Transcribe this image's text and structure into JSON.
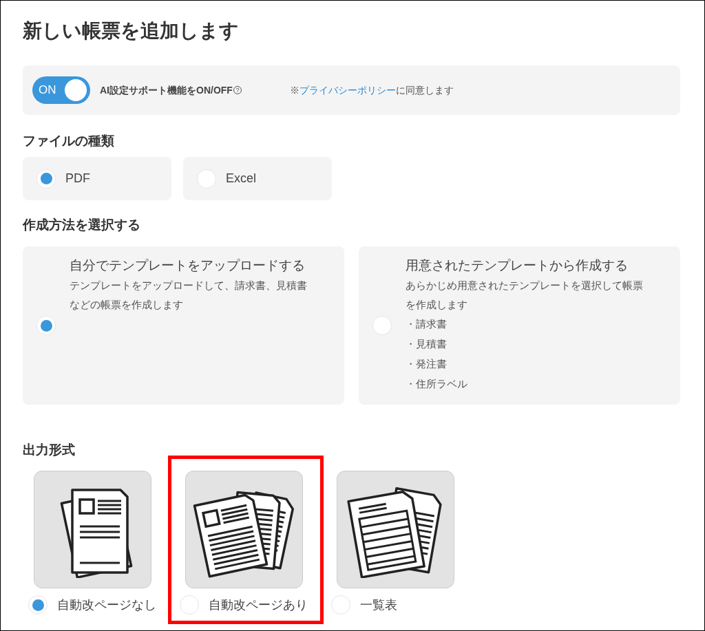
{
  "title": "新しい帳票を追加します",
  "ai_support": {
    "on": true,
    "toggle_label": "ON",
    "label": "AI設定サポート機能をON/OFF",
    "help_icon": "?",
    "note_prefix": "※",
    "privacy_link": "プライバシーポリシー",
    "note_suffix": "に同意します"
  },
  "file_type": {
    "heading": "ファイルの種類",
    "options": [
      {
        "label": "PDF",
        "selected": true
      },
      {
        "label": "Excel",
        "selected": false
      }
    ]
  },
  "method": {
    "heading": "作成方法を選択する",
    "options": [
      {
        "title": "自分でテンプレートをアップロードする",
        "description": "テンプレートをアップロードして、請求書、見積書などの帳票を作成します",
        "selected": true
      },
      {
        "title": "用意されたテンプレートから作成する",
        "description": "あらかじめ用意されたテンプレートを選択して帳票を作成します",
        "items": [
          "・請求書",
          "・見積書",
          "・発注書",
          "・住所ラベル"
        ],
        "selected": false
      }
    ]
  },
  "output": {
    "heading": "出力形式",
    "options": [
      {
        "kind": "single",
        "label": "自動改ページなし",
        "selected": true,
        "highlighted": false
      },
      {
        "kind": "multi",
        "label": "自動改ページあり",
        "selected": false,
        "highlighted": true
      },
      {
        "kind": "list",
        "label": "一覧表",
        "selected": false,
        "highlighted": false
      }
    ]
  }
}
